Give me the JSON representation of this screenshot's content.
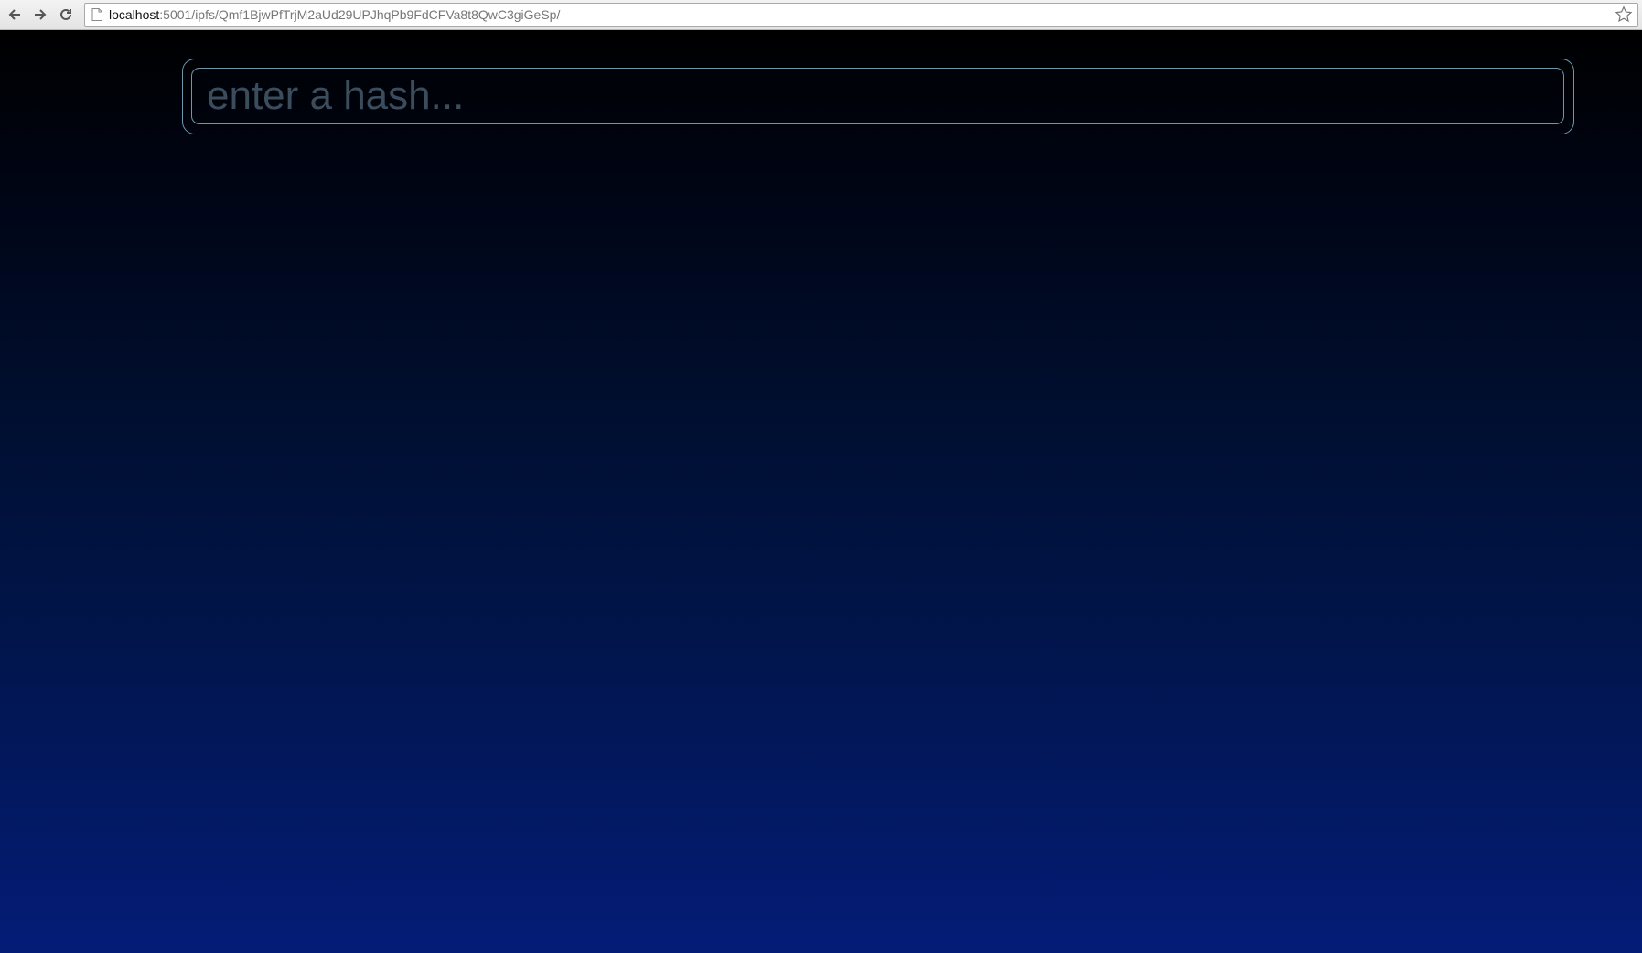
{
  "browser": {
    "url_host": "localhost",
    "url_rest": ":5001/ipfs/Qmf1BjwPfTrjM2aUd29UPJhqPb9FdCFVa8t8QwC3giGeSp/",
    "back_icon": "arrow-left-icon",
    "forward_icon": "arrow-right-icon",
    "reload_icon": "reload-icon",
    "page_icon": "document-icon",
    "bookmark_icon": "star-icon"
  },
  "search": {
    "placeholder": "enter a hash...",
    "value": ""
  },
  "colors": {
    "border": "#6e97ad",
    "placeholder": "#3b4c5c",
    "gradient_top": "#000000",
    "gradient_bottom": "#041c77"
  }
}
